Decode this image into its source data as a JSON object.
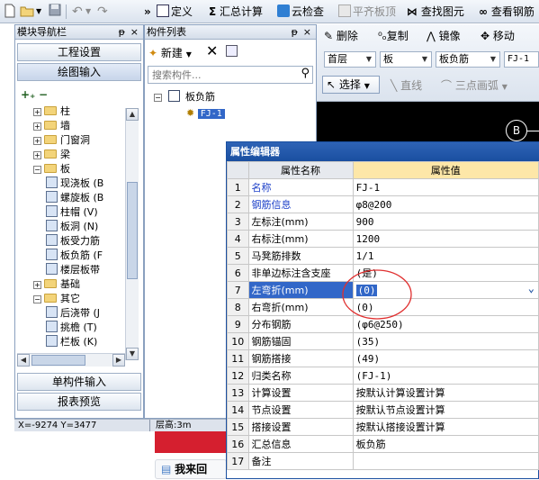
{
  "toolbar": {
    "define": "定义",
    "sum_calc": "汇总计算",
    "cloud_check": "云检查",
    "flat_roof": "平齐板顶",
    "find_element": "查找图元",
    "view_rebar": "查看钢筋"
  },
  "module_nav": {
    "title": "模块导航栏",
    "pin": "ᵽ",
    "close": "×",
    "project_settings": "工程设置",
    "drawing_input": "绘图输入",
    "tree": [
      {
        "label": "柱",
        "expander": "+"
      },
      {
        "label": "墙",
        "expander": "+"
      },
      {
        "label": "门窗洞",
        "expander": "+"
      },
      {
        "label": "梁",
        "expander": "+"
      },
      {
        "label": "板",
        "expander": "−"
      },
      {
        "label": "现浇板 (B",
        "leaf": true
      },
      {
        "label": "螺旋板 (B",
        "leaf": true
      },
      {
        "label": "柱帽 (V)",
        "leaf": true
      },
      {
        "label": "板洞 (N)",
        "leaf": true
      },
      {
        "label": "板受力筋",
        "leaf": true
      },
      {
        "label": "板负筋 (F",
        "leaf": true
      },
      {
        "label": "楼层板带",
        "leaf": true
      },
      {
        "label": "基础",
        "expander": "+"
      },
      {
        "label": "其它",
        "expander": "−"
      },
      {
        "label": "后浇带 (J",
        "leaf": true
      },
      {
        "label": "挑檐 (T)",
        "leaf": true
      },
      {
        "label": "栏板 (K)",
        "leaf": true
      }
    ],
    "single_input": "单构件输入",
    "report_preview": "报表预览"
  },
  "component_list": {
    "title": "构件列表",
    "pin": "ᵽ",
    "close": "×",
    "new_label": "新建",
    "search_placeholder": "搜索构件...",
    "group": "板负筋",
    "item": "FJ-1"
  },
  "edit_toolbar": {
    "delete": "删除",
    "copy": "复制",
    "mirror": "镜像",
    "move": "移动",
    "floor": "首层",
    "category": "板",
    "type": "板负筋",
    "element": "FJ-1",
    "select": "选择",
    "line": "直线",
    "arc": "三点画弧"
  },
  "canvas": {
    "axis_label": "B"
  },
  "status_bar": {
    "coords": "X=-9274  Y=3477",
    "floor_height": "层高:3m"
  },
  "property_editor": {
    "title": "属性编辑器",
    "col_name": "属性名称",
    "col_value": "属性值",
    "rows": [
      {
        "num": "1",
        "name": "名称",
        "value": "FJ-1",
        "blue": true
      },
      {
        "num": "2",
        "name": "钢筋信息",
        "value": "φ8@200",
        "blue": true
      },
      {
        "num": "3",
        "name": "左标注(mm)",
        "value": "900"
      },
      {
        "num": "4",
        "name": "右标注(mm)",
        "value": "1200"
      },
      {
        "num": "5",
        "name": "马凳筋排数",
        "value": "1/1"
      },
      {
        "num": "6",
        "name": "非单边标注含支座",
        "value": "(是)"
      },
      {
        "num": "7",
        "name": "左弯折(mm)",
        "value": "(0)",
        "selected": true
      },
      {
        "num": "8",
        "name": "右弯折(mm)",
        "value": "(0)"
      },
      {
        "num": "9",
        "name": "分布钢筋",
        "value": "(φ6@250)"
      },
      {
        "num": "10",
        "name": "钢筋锚固",
        "value": "(35)"
      },
      {
        "num": "11",
        "name": "钢筋搭接",
        "value": "(49)"
      },
      {
        "num": "12",
        "name": "归类名称",
        "value": "(FJ-1)"
      },
      {
        "num": "13",
        "name": "计算设置",
        "value": "按默认计算设置计算"
      },
      {
        "num": "14",
        "name": "节点设置",
        "value": "按默认节点设置计算"
      },
      {
        "num": "15",
        "name": "搭接设置",
        "value": "按默认搭接设置计算"
      },
      {
        "num": "16",
        "name": "汇总信息",
        "value": "板负筋"
      },
      {
        "num": "17",
        "name": "备注",
        "value": ""
      }
    ]
  },
  "bottom_bubble": "我来回",
  "colors": {
    "accent_header": "#1a4fa0",
    "selected_row": "#3267c8",
    "highlight_col": "#fde7a8",
    "annotation_circle": "#e03030",
    "red_strip": "#d51f2f"
  }
}
